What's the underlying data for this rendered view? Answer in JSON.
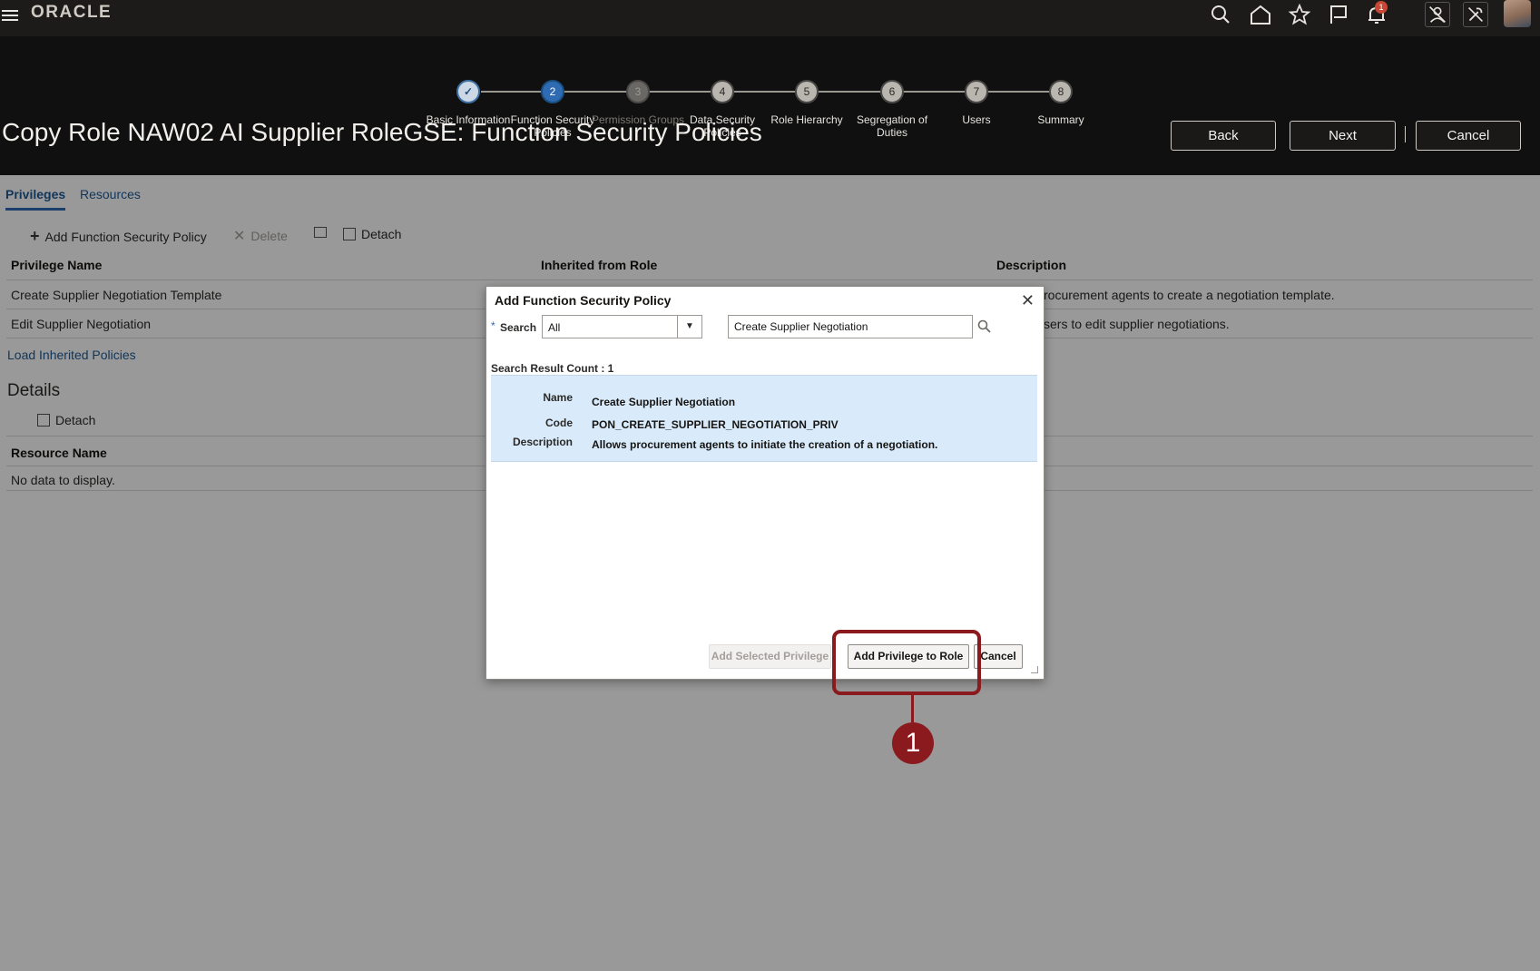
{
  "app": {
    "logo": "ORACLE"
  },
  "topbar_icons": [
    "search-icon",
    "home-icon",
    "star-icon",
    "flag-icon",
    "bell-icon",
    "user-slash-icon",
    "tools-icon"
  ],
  "notification_count": "1",
  "train": [
    {
      "number": "",
      "label": "Basic Information",
      "state": "done"
    },
    {
      "number": "2",
      "label": "Function Security Policies",
      "state": "current"
    },
    {
      "number": "3",
      "label": "Permission Groups",
      "state": "disabled"
    },
    {
      "number": "4",
      "label": "Data Security Policies",
      "state": "normal"
    },
    {
      "number": "5",
      "label": "Role Hierarchy",
      "state": "normal"
    },
    {
      "number": "6",
      "label": "Segregation of Duties",
      "state": "normal"
    },
    {
      "number": "7",
      "label": "Users",
      "state": "normal"
    },
    {
      "number": "8",
      "label": "Summary",
      "state": "normal"
    }
  ],
  "page_title": "Copy Role NAW02 AI Supplier RoleGSE: Function Security Policies",
  "header_buttons": {
    "back": "Back",
    "next": "Next",
    "cancel": "Cancel"
  },
  "tabs": {
    "privileges": "Privileges",
    "resources": "Resources"
  },
  "toolbar": {
    "add": "Add Function Security Policy",
    "delete": "Delete",
    "detach": "Detach"
  },
  "table": {
    "headers": {
      "name": "Privilege Name",
      "inherited": "Inherited from Role",
      "description": "Description"
    },
    "rows": [
      {
        "name": "Create Supplier Negotiation Template",
        "description": "rocurement agents to create a negotiation template."
      },
      {
        "name": "Edit Supplier Negotiation",
        "description": "sers to edit supplier negotiations."
      }
    ]
  },
  "load_inherited": "Load Inherited Policies",
  "details": {
    "title": "Details",
    "detach": "Detach",
    "resource_header": "Resource Name",
    "empty": "No data to display."
  },
  "dialog": {
    "title": "Add Function Security Policy",
    "search_label": "Search",
    "search_select": "All",
    "search_value": "Create Supplier Negotiation",
    "result_count": "Search Result Count : 1",
    "result": {
      "name_label": "Name",
      "name": "Create Supplier Negotiation",
      "code_label": "Code",
      "code": "PON_CREATE_SUPPLIER_NEGOTIATION_PRIV",
      "description_label": "Description",
      "description": "Allows procurement agents to initiate the creation of a negotiation."
    },
    "buttons": {
      "add_selected": "Add Selected Privilege",
      "add_to_role": "Add Privilege to Role",
      "cancel": "Cancel"
    }
  },
  "callout": {
    "number": "1",
    "color": "#8b1a1f"
  }
}
